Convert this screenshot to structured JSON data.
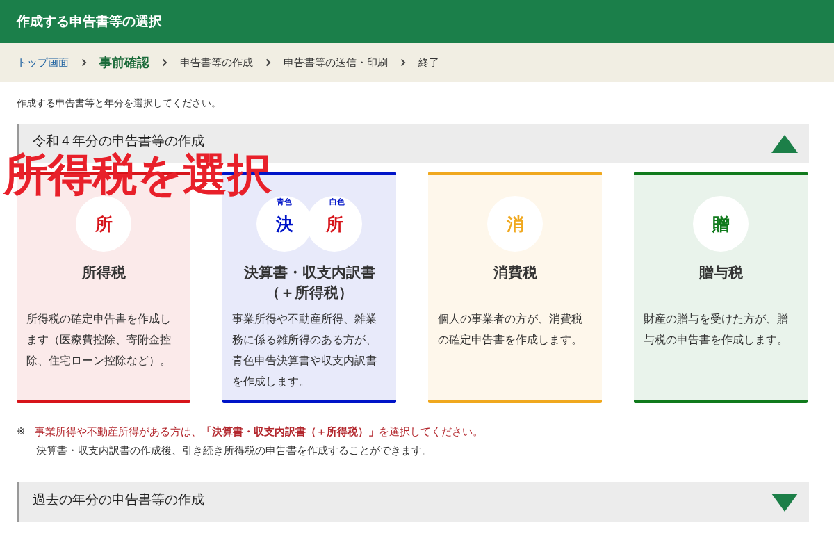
{
  "header": {
    "title": "作成する申告書等の選択"
  },
  "breadcrumb": [
    {
      "label": "トップ画面",
      "kind": "link"
    },
    {
      "label": "事前確認",
      "kind": "current"
    },
    {
      "label": "申告書等の作成",
      "kind": "step"
    },
    {
      "label": "申告書等の送信・印刷",
      "kind": "step"
    },
    {
      "label": "終了",
      "kind": "step"
    }
  ],
  "intro": "作成する申告書等と年分を選択してください。",
  "sections": [
    {
      "title": "令和４年分の申告書等の作成",
      "expanded": true,
      "cards": [
        {
          "title": "所得税",
          "color": "#d7141a",
          "badges": [
            {
              "char": "所",
              "color": "#d7141a"
            }
          ],
          "description": "所得税の確定申告書を作成します（医療費控除、寄附金控除、住宅ローン控除など）。"
        },
        {
          "title": "決算書・収支内訳書（＋所得税）",
          "color": "#0014c8",
          "badges": [
            {
              "char": "決",
              "color": "#0014c8",
              "label": "青色"
            },
            {
              "char": "所",
              "color": "#d7141a",
              "label": "白色"
            }
          ],
          "description": "事業所得や不動産所得、雑業務に係る雑所得のある方が、青色申告決算書や収支内訳書を作成します。"
        },
        {
          "title": "消費税",
          "color": "#f0a81e",
          "badges": [
            {
              "char": "消",
              "color": "#f0a81e"
            }
          ],
          "description": "個人の事業者の方が、消費税の確定申告書を作成します。"
        },
        {
          "title": "贈与税",
          "color": "#107a1c",
          "badges": [
            {
              "char": "贈",
              "color": "#107a1c"
            }
          ],
          "description": "財産の贈与を受けた方が、贈与税の申告書を作成します。"
        }
      ],
      "note": {
        "mark": "※",
        "line_1": "事業所得や不動産所得がある方は、**「決算書・収支内訳書（＋所得税）」**を選択してください。",
        "line_2": "決算書・収支内訳書の作成後、引き続き所得税の申告書を作成することができます。"
      }
    },
    {
      "title": "過去の年分の申告書等の作成",
      "expanded": false
    }
  ],
  "annotation": "所得税を選択"
}
